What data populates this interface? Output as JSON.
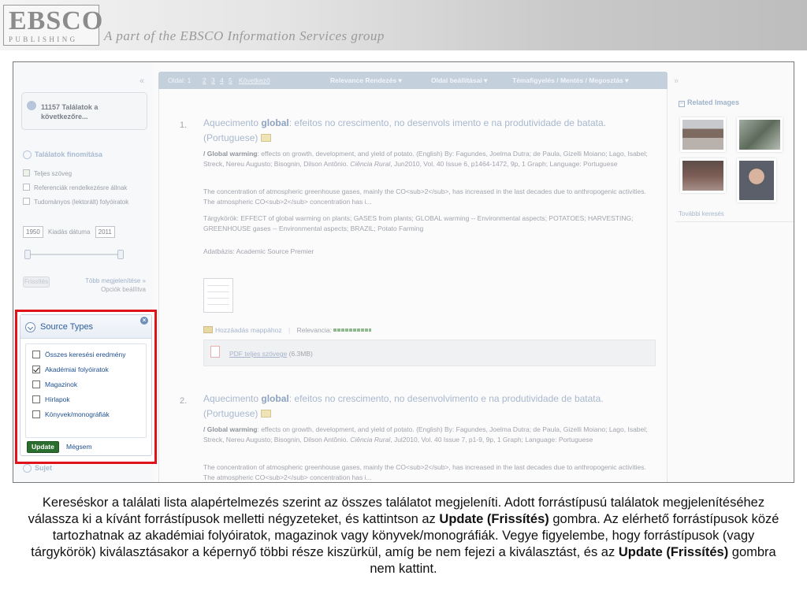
{
  "banner": {
    "logo_main": "EBSCO",
    "logo_sub": "PUBLISHING",
    "tagline": "A part of the EBSCO Information Services group"
  },
  "left_panel": {
    "collapse_glyph": "«",
    "next_box_text": "11157 Találatok a következőre...",
    "refine_header": "Találatok finomítása",
    "refine_items": [
      {
        "label": "Teljes szöveg",
        "checked": true
      },
      {
        "label": "Referenciák rendelkezésre állnak",
        "checked": false
      },
      {
        "label": "Tudományos (lektorált) folyóiratok",
        "checked": false
      }
    ],
    "date_from": "1950",
    "date_label": "Kiadás dátuma",
    "date_to": "2011",
    "update_label": "Frissítés",
    "more_link": "Több megjelenítése »",
    "options_link": "Opciók beállítva",
    "sujet_label": "Sujet"
  },
  "source_types": {
    "title": "Source Types",
    "close_glyph": "×",
    "items": [
      {
        "label": "Összes keresési eredmény",
        "checked": false
      },
      {
        "label": "Akadémiai folyóiratok",
        "checked": true
      },
      {
        "label": "Magazinok",
        "checked": false
      },
      {
        "label": "Hírlapok",
        "checked": false
      },
      {
        "label": "Könyvek/monográfiák",
        "checked": false
      }
    ],
    "update_button": "Update",
    "cancel_link": "Mégsem"
  },
  "toolbar": {
    "page_label": "Oldal: 1",
    "pages": [
      "2",
      "3",
      "4",
      "5"
    ],
    "next_link": "Következő",
    "sort": "Relevance Rendezés ▾",
    "page_options": "Oldal beállításai ▾",
    "share": "Témafigyelés / Mentés / Megosztás ▾"
  },
  "results": [
    {
      "num": "1.",
      "title_pre": "Aquecimento ",
      "title_bold": "global",
      "title_post": ": efeitos no crescimento, no desenvols imento e na produtividade de batata. (Portuguese)",
      "meta_bold": "/ Global warming",
      "meta_rest": ": effects on growth, development, and yield of potato. (English) By: Fagundes, Joelma Dutra; de Paula, Gizelli Moiano; Lago, Isabel; Streck, Nereu Augusto; Bisognin, Dilson Antônio.",
      "meta_journal": "Ciência Rural",
      "meta_tail": ", Jun2010, Vol. 40 Issue 6, p1464-1472, 9p, 1 Graph; Language: Portuguese",
      "abstract": "The concentration of atmospheric greenhouse gases, mainly the CO<sub>2</sub>, has increased in the last decades due to anthropogenic activities. The atmospheric CO<sub>2</sub> concentration has i...",
      "subjects": "Tárgykörök: EFFECT of global warming on plants; GASES from plants; GLOBAL warming -- Environmental aspects; POTATOES; HARVESTING; GREENHOUSE gases -- Environmental aspects; BRAZIL; Potato Farming",
      "database": "Adatbázis: Academic Source Premier",
      "add_folder": "Hozzáadás mappához",
      "relevance": "Relevancia:",
      "pdf_link": "PDF teljes szövege",
      "pdf_size": "(6.3MB)"
    },
    {
      "num": "2.",
      "title_pre": "Aquecimento ",
      "title_bold": "global",
      "title_post": ": efeitos no crescimento, no desenvolvimento e na produtividade de batata. (Portuguese)",
      "meta_bold": "/ Global warming",
      "meta_rest": ": effects on growth, development, and yield of potato. (English) By: Fagundes, Joelma Dutra; de Paula, Gizelli Moiano; Lago, Isabel; Streck, Nereu Augusto; Bisognin, Dilson Antônio.",
      "meta_journal": "Ciência Rural",
      "meta_tail": ", Jul2010, Vol. 40 Issue 7, p1-9, 9p, 1 Graph; Language: Portuguese",
      "abstract": "The concentration of atmospheric greenhouse gases, mainly the CO<sub>2</sub>, has increased in the last decades due to anthropogenic activities. The atmospheric CO<sub>2</sub> concentration has i..."
    }
  ],
  "right_panel": {
    "collapse_glyph": "»",
    "header": "Related Images",
    "more_search": "További keresés"
  },
  "caption": {
    "part1": "Kereséskor a találati lista alapértelmezés szerint az összes találatot megjeleníti. Adott forrástípusú találatok megjelenítéséhez válassza ki a kívánt forrástípusok melletti négyzeteket, és kattintson az ",
    "bold1": "Update (Frissítés)",
    "part2": " gombra. Az elérhető forrástípusok közé tartozhatnak az akadémiai folyóiratok, magazinok vagy könyvek/monográfiák. Vegye figyelembe, hogy forrástípusok (vagy tárgykörök) kiválasztásakor a képernyő többi része kiszürkül, amíg be nem fejezi a kiválasztást, és az ",
    "bold2": "Update (Frissítés)",
    "part3": " gombra nem kattint."
  },
  "colors": {
    "highlight_frame": "#e0131b",
    "update_button": "#2c6e2f",
    "link_blue": "#1f4f8f"
  }
}
